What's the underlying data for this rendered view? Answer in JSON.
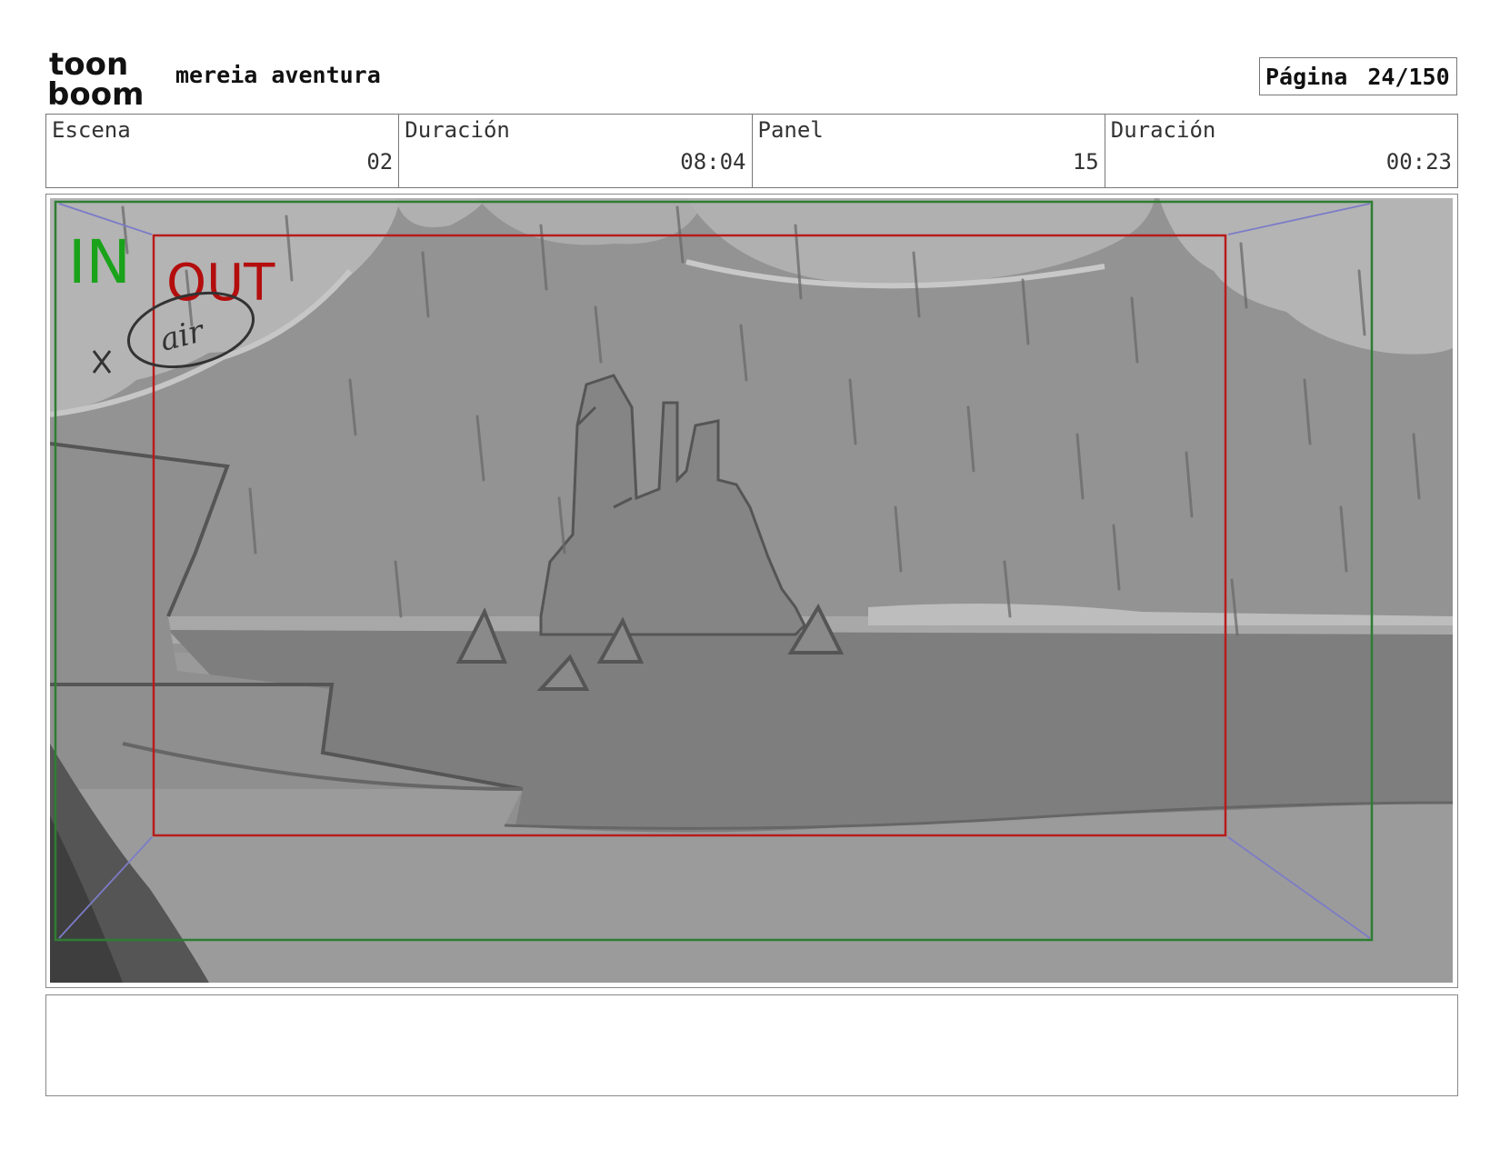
{
  "header": {
    "logo_text_top": "toon",
    "logo_text_bottom": "boom",
    "project_title": "mereia aventura",
    "page_label": "Página",
    "page_number": "24/150"
  },
  "info_bar": [
    {
      "label": "Escena",
      "value": "02"
    },
    {
      "label": "Duración",
      "value": "08:04"
    },
    {
      "label": "Panel",
      "value": "15"
    },
    {
      "label": "Duración",
      "value": "00:23"
    }
  ],
  "panel": {
    "in_label": "IN",
    "out_label": "OUT",
    "note_text": "air",
    "colors": {
      "in_frame": "#2e7d32",
      "out_frame": "#b71c1c",
      "in_text": "#1aa31a",
      "out_text": "#b40d0d",
      "guide": "#7c7cc8"
    }
  },
  "caption": ""
}
